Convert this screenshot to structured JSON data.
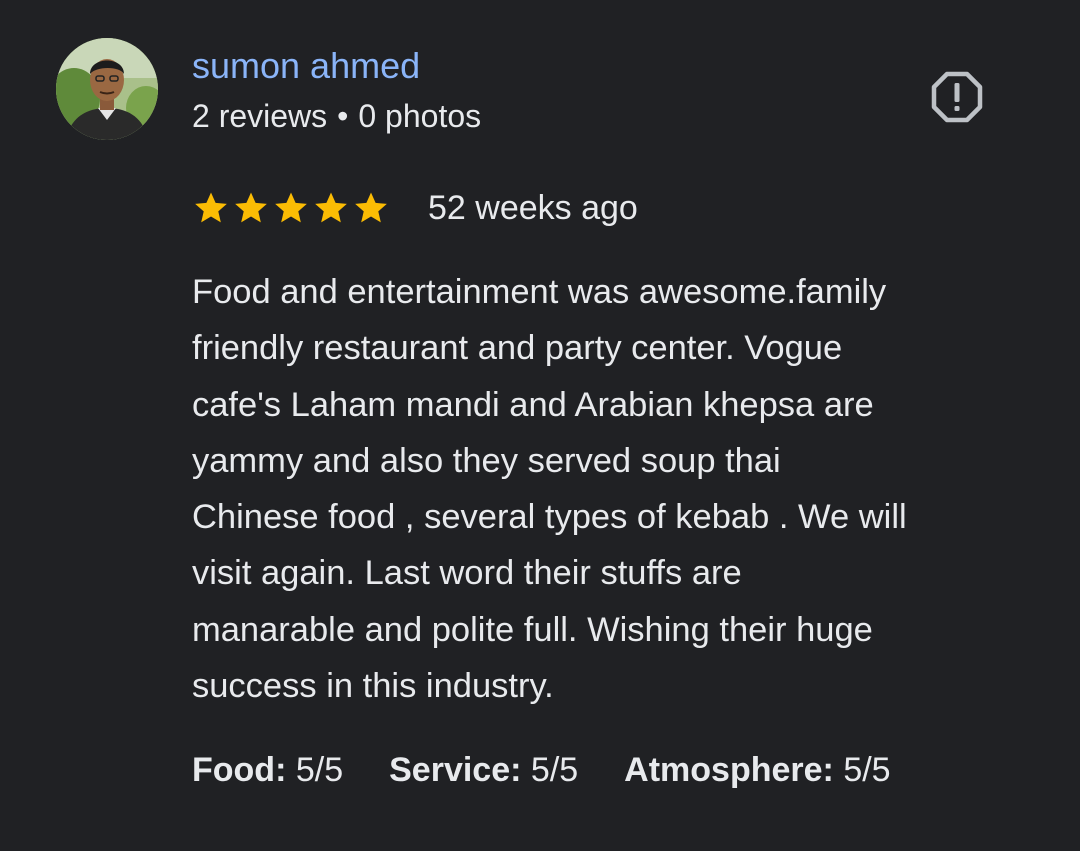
{
  "author": {
    "name": "sumon ahmed",
    "reviews": "2 reviews",
    "separator": "•",
    "photos": "0 photos"
  },
  "rating": {
    "stars": 5,
    "max_stars": 5,
    "star_color": "#fbbc04",
    "time": "52 weeks ago"
  },
  "review": {
    "lines": [
      "Food and entertainment was awesome.family",
      "friendly restaurant and party center. Vogue",
      "cafe's Laham mandi and Arabian khepsa are",
      "yammy and also they served soup thai",
      "Chinese food , several types of kebab . We will",
      "visit again. Last word their stuffs are",
      "manarable and polite full. Wishing their huge",
      "success in this industry."
    ]
  },
  "attributes": [
    {
      "label": "Food:",
      "value": "5/5"
    },
    {
      "label": "Service:",
      "value": "5/5"
    },
    {
      "label": "Atmosphere:",
      "value": "5/5"
    }
  ],
  "icons": {
    "flag": "report-flag-icon"
  },
  "colors": {
    "background": "#202124",
    "name": "#8ab4f8",
    "text": "#e8eaed",
    "icon": "#bdc1c6"
  }
}
